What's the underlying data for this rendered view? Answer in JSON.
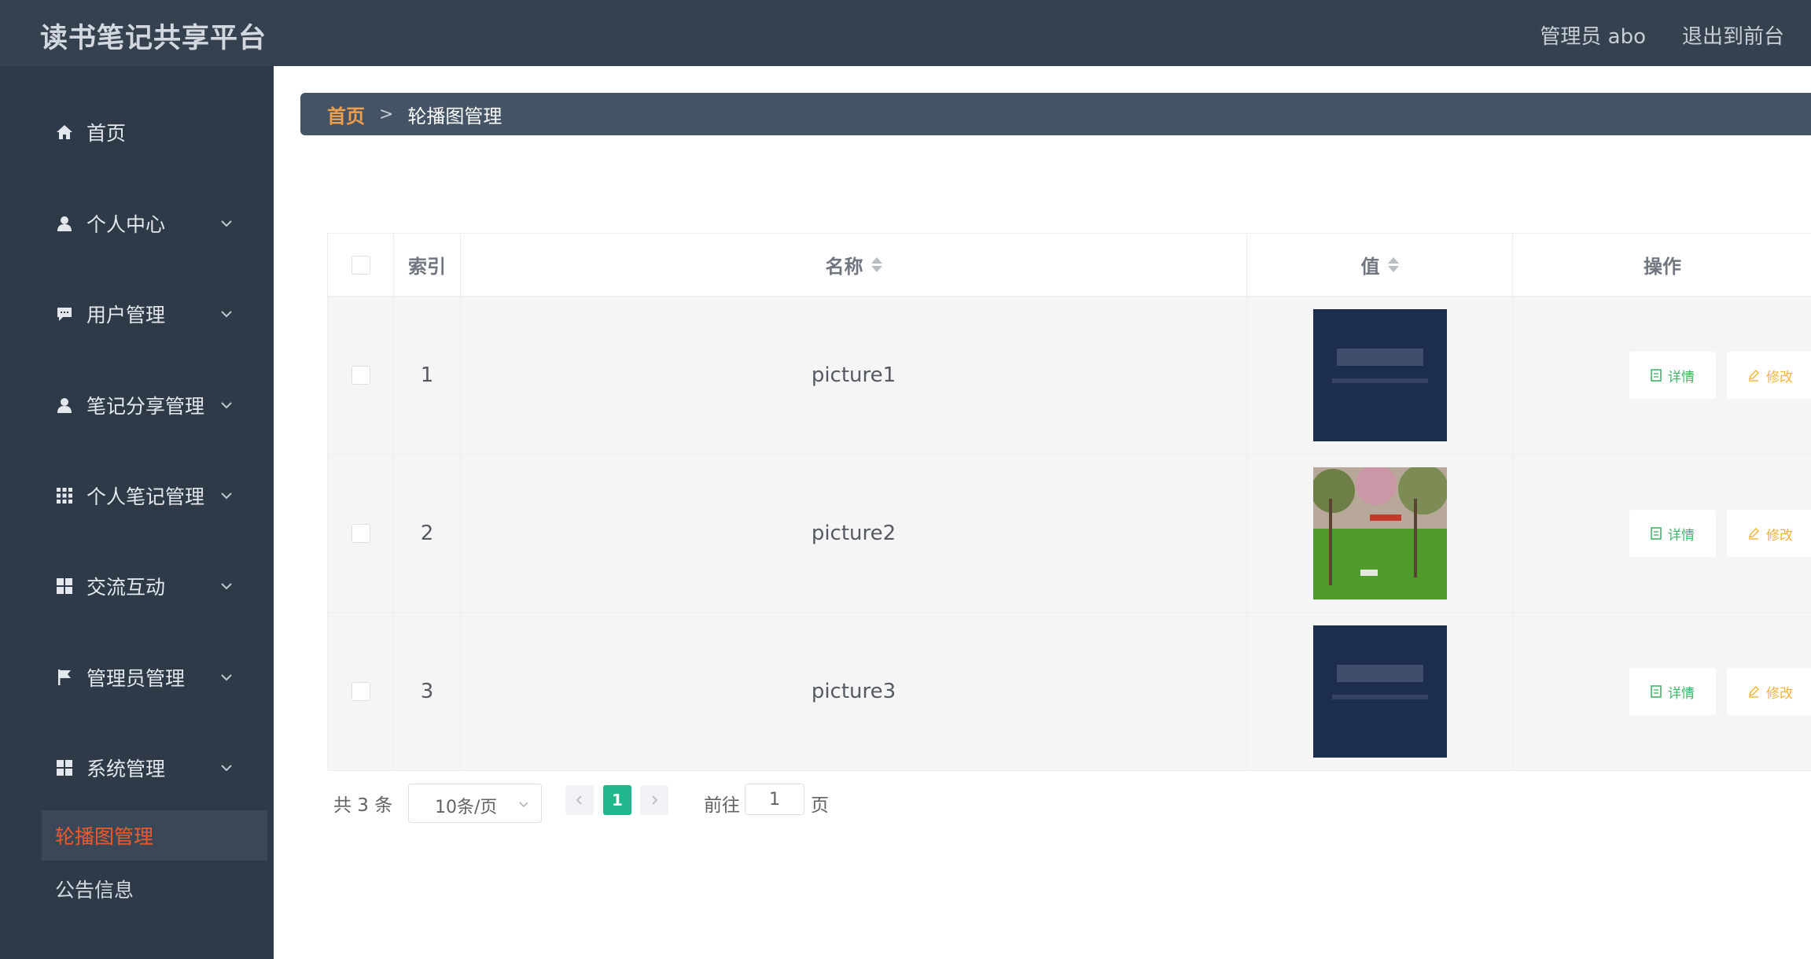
{
  "header": {
    "brand": "读书笔记共享平台",
    "admin": "管理员 abo",
    "logout": "退出到前台"
  },
  "sidebar": {
    "items": [
      {
        "label": "首页",
        "icon": "home-icon"
      },
      {
        "label": "个人中心",
        "icon": "user-icon"
      },
      {
        "label": "用户管理",
        "icon": "chat-icon"
      },
      {
        "label": "笔记分享管理",
        "icon": "user-icon"
      },
      {
        "label": "个人笔记管理",
        "icon": "grid9-icon"
      },
      {
        "label": "交流互动",
        "icon": "grid4-icon"
      },
      {
        "label": "管理员管理",
        "icon": "flag-icon"
      },
      {
        "label": "系统管理",
        "icon": "grid4-icon"
      }
    ],
    "sub_items": [
      {
        "label": "轮播图管理",
        "active": true
      },
      {
        "label": "公告信息",
        "active": false
      }
    ],
    "active_color": "#ef5a2a"
  },
  "breadcrumb": {
    "home": "首页",
    "separator": ">",
    "current": "轮播图管理"
  },
  "table": {
    "columns": {
      "index": "索引",
      "name": "名称",
      "value": "值",
      "actions": "操作"
    },
    "rows": [
      {
        "index": "1",
        "name": "picture1",
        "image": "dark-blue-banner"
      },
      {
        "index": "2",
        "name": "picture2",
        "image": "garden-photo"
      },
      {
        "index": "3",
        "name": "picture3",
        "image": "dark-blue-banner"
      }
    ],
    "detail_label": "详情",
    "edit_label": "修改"
  },
  "pagination": {
    "total": "共 3 条",
    "page_size": "10条/页",
    "current_page": "1",
    "goto_label": "前往",
    "goto_value": "1",
    "goto_suffix": "页"
  },
  "colors": {
    "header_bg": "#364150",
    "sidebar_bg": "#2e3a48",
    "accent_green": "#21b78c",
    "crumb_home": "#f0a04b"
  }
}
